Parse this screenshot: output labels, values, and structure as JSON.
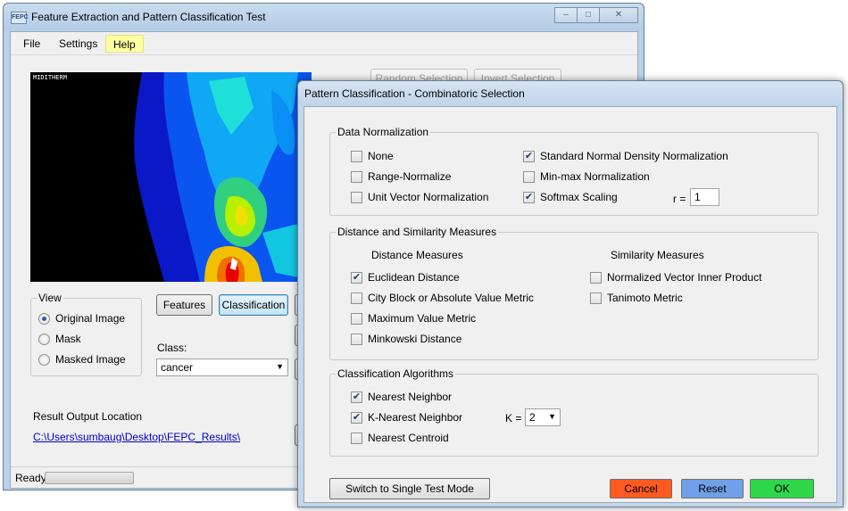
{
  "main_window": {
    "icon_text": "FEPC",
    "title": "Feature Extraction and Pattern Classification Test",
    "menu": [
      "File",
      "Settings",
      "Help"
    ],
    "image_label": "MIDITHERM",
    "view_group": {
      "title": "View",
      "options": [
        "Original Image",
        "Mask",
        "Masked Image"
      ],
      "selected": "Original Image"
    },
    "features_button": "Features",
    "classification_button": "Classification",
    "class_label": "Class:",
    "class_value": "cancer",
    "output_label": "Result Output Location",
    "output_path": "C:\\Users\\sumbaug\\Desktop\\FEPC_Results\\",
    "behind_buttons": [
      "Random Selection",
      "Invert Selection"
    ],
    "status": "Ready"
  },
  "dialog": {
    "title": "Pattern Classification - Combinatoric Selection",
    "data_normalization": {
      "title": "Data Normalization",
      "left": [
        {
          "label": "None",
          "checked": false
        },
        {
          "label": "Range-Normalize",
          "checked": false
        },
        {
          "label": "Unit Vector Normalization",
          "checked": false
        }
      ],
      "right": [
        {
          "label": "Standard Normal Density Normalization",
          "checked": true
        },
        {
          "label": "Min-max Normalization",
          "checked": false
        },
        {
          "label": "Softmax Scaling",
          "checked": true
        }
      ],
      "r_label": "r =",
      "r_value": "1"
    },
    "distance": {
      "title": "Distance and Similarity Measures",
      "distance_header": "Distance Measures",
      "similarity_header": "Similarity Measures",
      "distance_items": [
        {
          "label": "Euclidean Distance",
          "checked": true
        },
        {
          "label": "City Block or Absolute Value Metric",
          "checked": false
        },
        {
          "label": "Maximum Value Metric",
          "checked": false
        },
        {
          "label": "Minkowski Distance",
          "checked": false
        }
      ],
      "similarity_items": [
        {
          "label": "Normalized Vector Inner Product",
          "checked": false
        },
        {
          "label": "Tanimoto Metric",
          "checked": false
        }
      ]
    },
    "algorithms": {
      "title": "Classification Algorithms",
      "items": [
        {
          "label": "Nearest Neighbor",
          "checked": true
        },
        {
          "label": "K-Nearest Neighbor",
          "checked": true
        },
        {
          "label": "Nearest Centroid",
          "checked": false
        }
      ],
      "k_label": "K =",
      "k_value": "2"
    },
    "buttons": {
      "switch": "Switch to Single Test Mode",
      "cancel": "Cancel",
      "reset": "Reset",
      "ok": "OK"
    },
    "colors": {
      "cancel": "#ff5a1f",
      "reset": "#6fa0e8",
      "ok": "#2fd64a"
    }
  }
}
